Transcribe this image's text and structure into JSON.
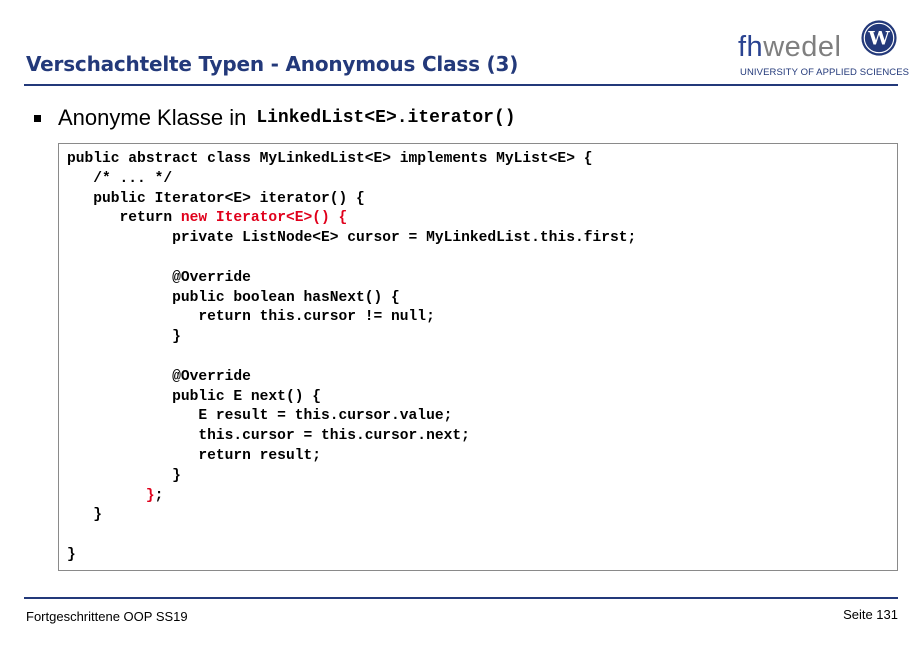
{
  "slide": {
    "title": "Verschachtelte Typen - Anonymous Class (3)",
    "bullet_text": "Anonyme Klasse in",
    "bullet_code": "LinkedList<E>.iterator()"
  },
  "logo": {
    "word_fh": "fh",
    "word_wedel": "wedel",
    "subtitle": "UNIVERSITY OF APPLIED SCIENCES",
    "seal_letter": "W",
    "colors": {
      "primary": "#23397a",
      "secondary": "#7f7f7f"
    }
  },
  "code": {
    "lines": [
      [
        {
          "t": "public abstract class MyLinkedList<E> implements MyList<E> {"
        }
      ],
      [
        {
          "t": "   /* ... */"
        }
      ],
      [
        {
          "t": "   public Iterator<E> iterator() {"
        }
      ],
      [
        {
          "t": "      return "
        },
        {
          "t": "new Iterator<E>() {",
          "red": true
        }
      ],
      [
        {
          "t": "            private ListNode<E> cursor = MyLinkedList.this.first;"
        }
      ],
      [
        {
          "t": ""
        }
      ],
      [
        {
          "t": "            @Override"
        }
      ],
      [
        {
          "t": "            public boolean hasNext() {"
        }
      ],
      [
        {
          "t": "               return this.cursor != null;"
        }
      ],
      [
        {
          "t": "            }"
        }
      ],
      [
        {
          "t": ""
        }
      ],
      [
        {
          "t": "            @Override"
        }
      ],
      [
        {
          "t": "            public E next() {"
        }
      ],
      [
        {
          "t": "               E result = this.cursor.value;"
        }
      ],
      [
        {
          "t": "               this.cursor = this.cursor.next;"
        }
      ],
      [
        {
          "t": "               return result;"
        }
      ],
      [
        {
          "t": "            }"
        }
      ],
      [
        {
          "t": "         "
        },
        {
          "t": "}",
          "red": true
        },
        {
          "t": ";"
        }
      ],
      [
        {
          "t": "   }"
        }
      ],
      [
        {
          "t": ""
        }
      ],
      [
        {
          "t": "}"
        }
      ]
    ],
    "highlight_color": "#e0001b"
  },
  "footer": {
    "left": "Fortgeschrittene OOP SS19",
    "right": "Seite 131"
  }
}
